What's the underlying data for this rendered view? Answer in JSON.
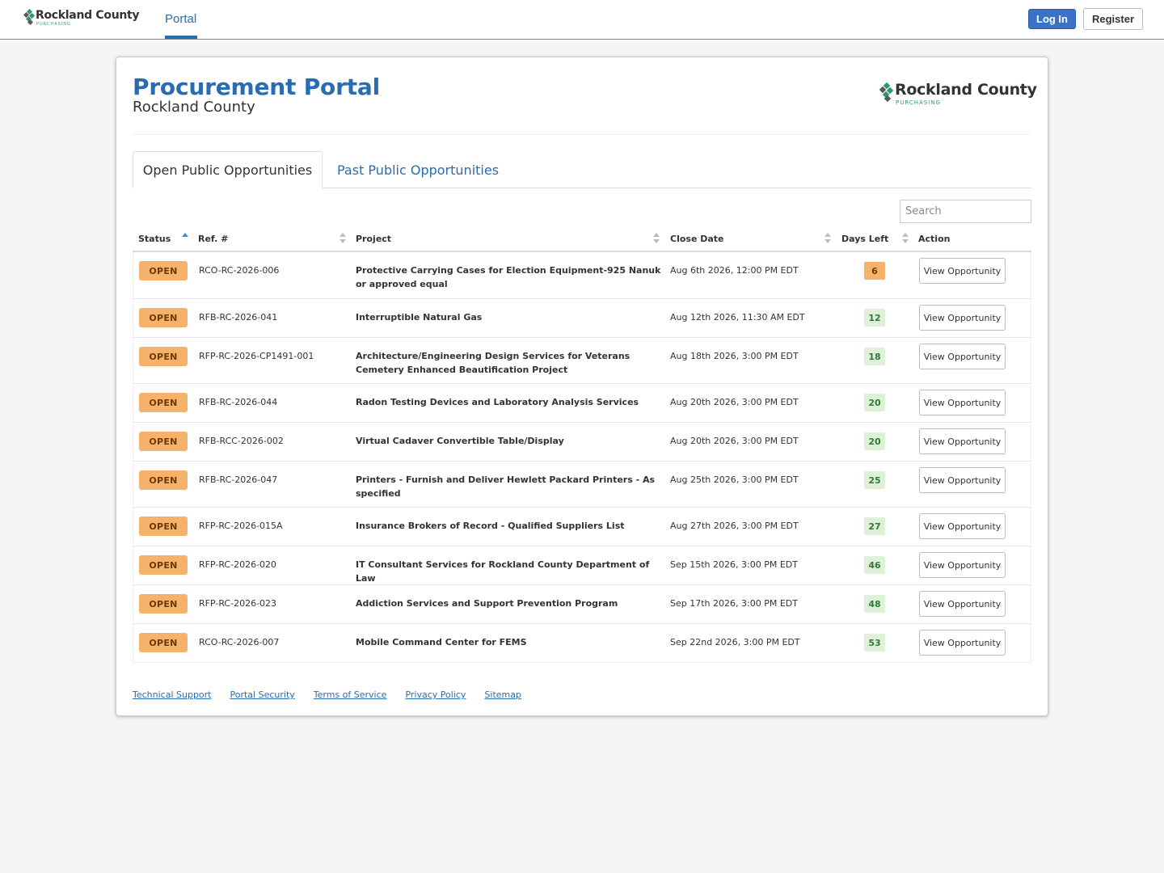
{
  "nav": {
    "brand_name": "Rockland County",
    "brand_sub": "PURCHASING",
    "portal_tab": "Portal",
    "login_label": "Log In",
    "register_label": "Register"
  },
  "header": {
    "title": "Procurement Portal",
    "subtitle": "Rockland County",
    "logo_name": "Rockland County",
    "logo_sub": "PURCHASING"
  },
  "tabs": {
    "open": "Open Public Opportunities",
    "past": "Past Public Opportunities"
  },
  "search": {
    "placeholder": "Search"
  },
  "table": {
    "columns": [
      "Status",
      "Ref. #",
      "Project",
      "Close Date",
      "Days Left",
      "Action"
    ],
    "rows": [
      {
        "status": "OPEN",
        "ref": "RCO-RC-2026-006",
        "project": "Protective Carrying Cases for Election Equipment-925 Nanuk or approved equal",
        "close": "Aug 6th 2026, 12:00 PM EDT",
        "days": "6",
        "action": "View Opportunity"
      },
      {
        "status": "OPEN",
        "ref": "RFB-RC-2026-041",
        "project": "Interruptible Natural Gas",
        "close": "Aug 12th 2026, 11:30 AM EDT",
        "days": "12",
        "action": "View Opportunity"
      },
      {
        "status": "OPEN",
        "ref": "RFP-RC-2026-CP1491-001",
        "project": "Architecture/Engineering Design Services for Veterans Cemetery Enhanced Beautification Project",
        "close": "Aug 18th 2026, 3:00 PM EDT",
        "days": "18",
        "action": "View Opportunity"
      },
      {
        "status": "OPEN",
        "ref": "RFB-RC-2026-044",
        "project": "Radon Testing Devices and Laboratory Analysis Services",
        "close": "Aug 20th 2026, 3:00 PM EDT",
        "days": "20",
        "action": "View Opportunity"
      },
      {
        "status": "OPEN",
        "ref": "RFB-RCC-2026-002",
        "project": "Virtual Cadaver Convertible Table/Display",
        "close": "Aug 20th 2026, 3:00 PM EDT",
        "days": "20",
        "action": "View Opportunity"
      },
      {
        "status": "OPEN",
        "ref": "RFB-RC-2026-047",
        "project": "Printers - Furnish and Deliver Hewlett Packard Printers - As specified",
        "close": "Aug 25th 2026, 3:00 PM EDT",
        "days": "25",
        "action": "View Opportunity"
      },
      {
        "status": "OPEN",
        "ref": "RFP-RC-2026-015A",
        "project": "Insurance Brokers of Record - Qualified Suppliers List",
        "close": "Aug 27th 2026, 3:00 PM EDT",
        "days": "27",
        "action": "View Opportunity"
      },
      {
        "status": "OPEN",
        "ref": "RFP-RC-2026-020",
        "project": "IT Consultant Services for Rockland County Department of Law",
        "close": "Sep 15th 2026, 3:00 PM EDT",
        "days": "46",
        "action": "View Opportunity"
      },
      {
        "status": "OPEN",
        "ref": "RFP-RC-2026-023",
        "project": "Addiction Services and Support Prevention Program",
        "close": "Sep 17th 2026, 3:00 PM EDT",
        "days": "48",
        "action": "View Opportunity"
      },
      {
        "status": "OPEN",
        "ref": "RCO-RC-2026-007",
        "project": "Mobile Command Center for FEMS",
        "close": "Sep 22nd 2026, 3:00 PM EDT",
        "days": "53",
        "action": "View Opportunity"
      }
    ]
  },
  "footer": {
    "links": [
      "Technical Support",
      "Portal Security",
      "Terms of Service",
      "Privacy Policy",
      "Sitemap"
    ]
  },
  "colors": {
    "accent": "#2a6cb0",
    "open_badge": "#f6b26b",
    "days_ok": "#dff0d8",
    "brand_green": "#2c9a68"
  },
  "icons": {
    "brand": "rockland-diamond-logo-icon",
    "sort": "sort-arrows-icon"
  }
}
